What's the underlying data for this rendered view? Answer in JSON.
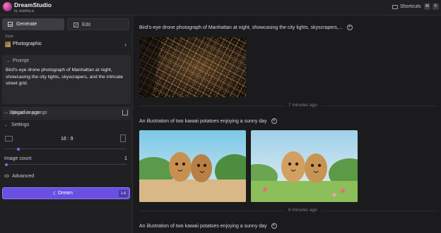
{
  "app": {
    "name": "DreamStudio",
    "byline": "by stability.ai",
    "shortcuts_label": "Shortcuts",
    "shortcut_keys": [
      "⌘",
      "K"
    ]
  },
  "sidebar": {
    "tabs": [
      {
        "label": "Generate",
        "icon": "generate-icon",
        "active": true
      },
      {
        "label": "Edit",
        "icon": "edit-icon",
        "active": false
      }
    ],
    "style": {
      "label": "Style",
      "value": "Photographic"
    },
    "prompt": {
      "label": "Prompt",
      "text": "Bird's-eye drone photograph of Manhattan at night, showcasing the city lights, skyscrapers, and the intricate street grid."
    },
    "negative_prompt": {
      "label": "Negative prompt"
    },
    "upload_image": {
      "label": "Upload image"
    },
    "settings": {
      "label": "Settings",
      "aspect_ratio": "16 : 9",
      "aspect_slider": 0.1,
      "image_count_label": "Image count",
      "image_count": "1",
      "count_slider": 0.0,
      "advanced_label": "Advanced"
    },
    "dream_button": {
      "label": "Dream",
      "credits": "1.6"
    },
    "accent": "#6a4fe0"
  },
  "feed": [
    {
      "prompt": "Bird's-eye drone photograph of Manhattan at night, showcasing the city lights, skyscrapers,...",
      "time": "7 minutes ago"
    },
    {
      "prompt": "An illustration of two kawaii potatoes enjoying a sunny day",
      "time": "8 minutes ago"
    },
    {
      "prompt": "An illustration of two kawaii potatoes enjoying a sunny day"
    }
  ]
}
